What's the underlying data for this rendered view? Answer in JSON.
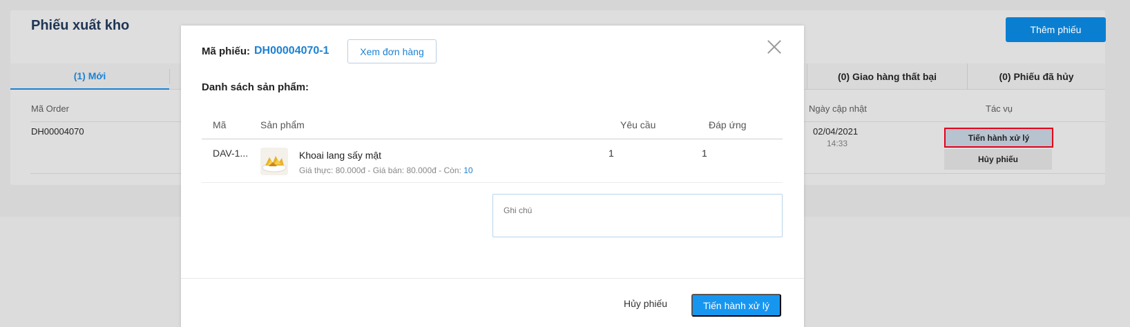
{
  "page": {
    "title": "Phiếu xuất kho",
    "add_button": "Thêm phiếu",
    "tabs": {
      "new": "(1) Mới",
      "delivery_failed": "(0) Giao hàng thất bại",
      "cancelled": "(0) Phiếu đã hủy"
    },
    "columns": {
      "order_code": "Mã Order",
      "updated_date": "Ngày cập nhật",
      "actions": "Tác vụ"
    },
    "row": {
      "order_code": "DH00004070",
      "date": "02/04/2021",
      "time": "14:33",
      "process_label": "Tiến hành xử lý",
      "cancel_label": "Hủy phiếu"
    }
  },
  "modal": {
    "code_label": "Mã phiếu:",
    "code_value": "DH00004070-1",
    "view_order_button": "Xem đơn hàng",
    "section_title": "Danh sách sản phẩm:",
    "table": {
      "headers": {
        "code": "Mã",
        "product": "Sản phẩm",
        "requested": "Yêu cầu",
        "fulfilled": "Đáp ứng"
      },
      "rows": [
        {
          "code": "DAV-1...",
          "name": "Khoai lang sấy mật",
          "price_text": "Giá thực: 80.000đ - Giá bán: 80.000đ - Còn: ",
          "stock": "10",
          "requested": "1",
          "fulfilled": "1"
        }
      ]
    },
    "note_placeholder": "Ghi chú",
    "footer": {
      "cancel_label": "Hủy phiếu",
      "process_label": "Tiến hành xử lý"
    }
  },
  "colors": {
    "accent": "#1b82d3",
    "primary_button": "#1796f0",
    "highlight_border": "#e2001a"
  }
}
